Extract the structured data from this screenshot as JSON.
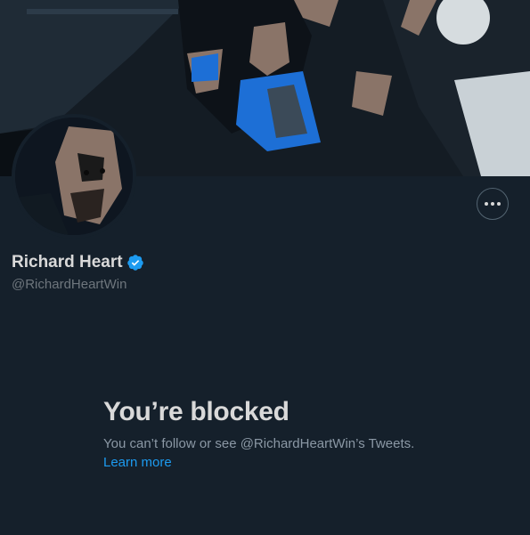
{
  "profile": {
    "display_name": "Richard Heart",
    "handle": "@RichardHeartWin",
    "verified": true
  },
  "icons": {
    "verified": "verified-badge-icon",
    "more": "more-horizontal-icon"
  },
  "blocked": {
    "title": "You’re blocked",
    "message": "You can’t follow or see @RichardHeartWin’s Tweets.",
    "learn_more": "Learn more"
  },
  "colors": {
    "background": "#15202b",
    "accent": "#1d9bf0",
    "primary_text": "#d9d9d9",
    "secondary_text": "#8b98a5"
  }
}
